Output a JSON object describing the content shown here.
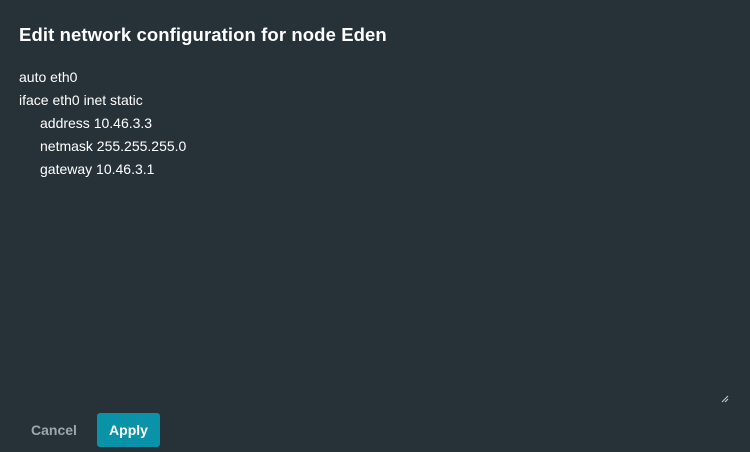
{
  "dialog": {
    "title": "Edit network configuration for node Eden"
  },
  "editor": {
    "lines": [
      "auto eth0",
      "iface eth0 inet static",
      "address 10.46.3.3",
      "netmask 255.255.255.0",
      "gateway 10.46.3.1"
    ],
    "resize_icon": "resize-grip-icon"
  },
  "actions": {
    "cancel_label": "Cancel",
    "apply_label": "Apply"
  },
  "colors": {
    "background": "#263238",
    "accent": "#0a93a8",
    "muted_text": "#9ea7ab"
  }
}
